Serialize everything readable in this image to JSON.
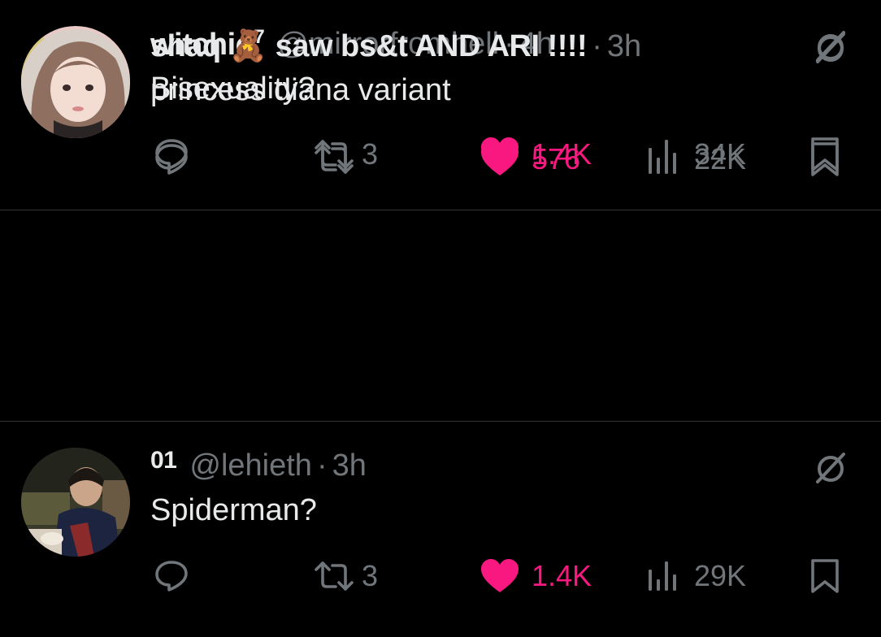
{
  "colors": {
    "background": "#000000",
    "text_primary": "#e7e9ea",
    "text_secondary": "#71767b",
    "like_active": "#f91880",
    "divider": "#2f3336"
  },
  "tweets": [
    {
      "display_name": "witchie",
      "name_superscript": "7",
      "handle": "@mirrorfromhell",
      "separator": "·",
      "time": "4h",
      "text": "Bisexuality?",
      "retweets": "3",
      "likes": "1.4K",
      "views": "34K",
      "liked": true,
      "icons": [
        "reply-icon",
        "retweet-icon",
        "heart-icon",
        "views-icon",
        "bookmark-icon",
        "grok-icon"
      ]
    },
    {
      "display_name": "01",
      "handle": "@lehieth",
      "separator": "·",
      "time": "3h",
      "text": "Spiderman?",
      "retweets": "3",
      "likes": "1.4K",
      "views": "29K",
      "liked": true,
      "icons": [
        "reply-icon",
        "retweet-icon",
        "heart-icon",
        "views-icon",
        "bookmark-icon",
        "grok-icon"
      ]
    },
    {
      "display_name": "shaq 🧸 saw bs&t AND ARI !!!!",
      "handle": "",
      "separator": "·",
      "time": "3h",
      "text": "princess diana variant",
      "retweets": "",
      "likes": "576",
      "views": "22K",
      "liked": true,
      "icons": [
        "reply-icon",
        "retweet-icon",
        "heart-icon",
        "views-icon",
        "bookmark-icon",
        "grok-icon"
      ]
    }
  ]
}
